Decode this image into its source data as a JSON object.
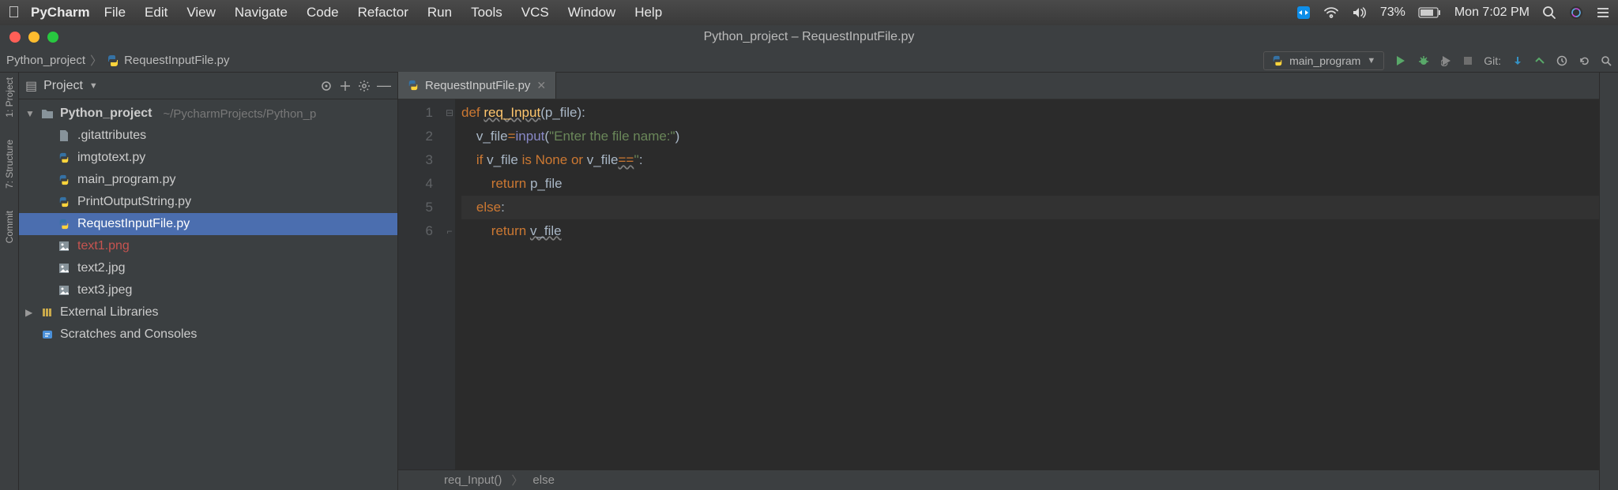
{
  "menubar": {
    "appname": "PyCharm",
    "items": [
      "File",
      "Edit",
      "View",
      "Navigate",
      "Code",
      "Refactor",
      "Run",
      "Tools",
      "VCS",
      "Window",
      "Help"
    ],
    "battery_pct": "73%",
    "clock": "Mon 7:02 PM"
  },
  "window": {
    "title": "Python_project – RequestInputFile.py"
  },
  "breadcrumb": {
    "project": "Python_project",
    "file": "RequestInputFile.py"
  },
  "run_config": {
    "name": "main_program"
  },
  "git_label": "Git:",
  "leftrail": {
    "items": [
      "1: Project",
      "7: Structure",
      "Commit"
    ]
  },
  "project_panel": {
    "title": "Project",
    "root": {
      "name": "Python_project",
      "path": "~/PycharmProjects/Python_p"
    },
    "files": [
      {
        "name": ".gitattributes",
        "type": "file"
      },
      {
        "name": "imgtotext.py",
        "type": "py"
      },
      {
        "name": "main_program.py",
        "type": "py"
      },
      {
        "name": "PrintOutputString.py",
        "type": "py"
      },
      {
        "name": "RequestInputFile.py",
        "type": "py",
        "selected": true
      },
      {
        "name": "text1.png",
        "type": "img",
        "red": true
      },
      {
        "name": "text2.jpg",
        "type": "img"
      },
      {
        "name": "text3.jpeg",
        "type": "img"
      }
    ],
    "external": "External Libraries",
    "scratches": "Scratches and Consoles"
  },
  "tabs": [
    {
      "label": "RequestInputFile.py"
    }
  ],
  "code": {
    "lines": [
      {
        "n": 1,
        "tokens": [
          [
            "kw",
            "def "
          ],
          [
            "fn uline",
            "req_Input"
          ],
          [
            "id",
            "(p_file):"
          ]
        ]
      },
      {
        "n": 2,
        "tokens": [
          [
            "id",
            "    v_file"
          ],
          [
            "kw",
            "="
          ],
          [
            "builtin",
            "input"
          ],
          [
            "id",
            "("
          ],
          [
            "str",
            "\"Enter the file name:\""
          ],
          [
            "id",
            ")"
          ]
        ]
      },
      {
        "n": 3,
        "tokens": [
          [
            "id",
            "    "
          ],
          [
            "kw",
            "if "
          ],
          [
            "id",
            "v_file "
          ],
          [
            "kw",
            "is "
          ],
          [
            "kw",
            "None "
          ],
          [
            "kw",
            "or "
          ],
          [
            "id",
            "v_file"
          ],
          [
            "kw uline",
            "=="
          ],
          [
            "str",
            "''"
          ],
          [
            "id",
            ":"
          ]
        ]
      },
      {
        "n": 4,
        "tokens": [
          [
            "id",
            "        "
          ],
          [
            "kw",
            "return "
          ],
          [
            "id",
            "p_file"
          ]
        ]
      },
      {
        "n": 5,
        "hl": true,
        "tokens": [
          [
            "id",
            "    "
          ],
          [
            "kw",
            "else"
          ],
          [
            "id",
            ":"
          ]
        ]
      },
      {
        "n": 6,
        "tokens": [
          [
            "id",
            "        "
          ],
          [
            "kw",
            "return "
          ],
          [
            "id uline",
            "v_file"
          ]
        ]
      }
    ]
  },
  "editor_breadcrumb": {
    "fn": "req_Input()",
    "branch": "else"
  }
}
